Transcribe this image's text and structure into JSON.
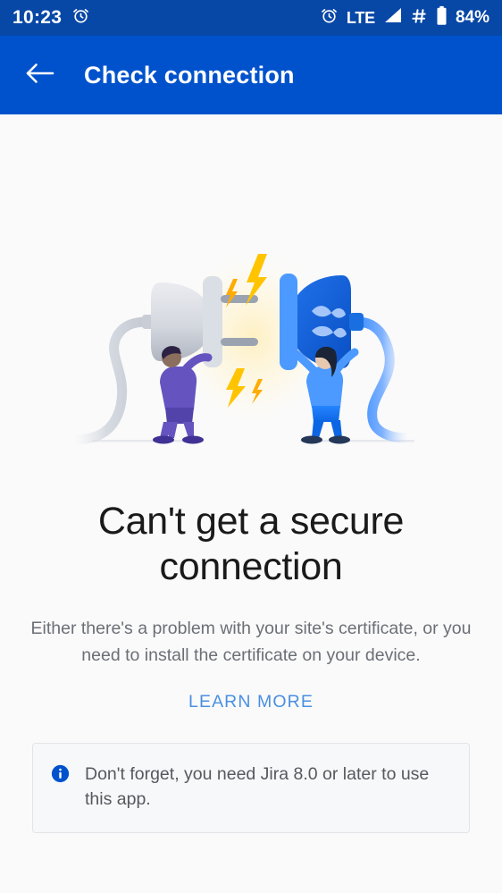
{
  "statusbar": {
    "time": "10:23",
    "alarm_icon": "alarm-clock-icon",
    "network_label": "LTE",
    "signal_icon": "signal-bars-icon",
    "hash_icon": "hash-icon",
    "battery_icon": "battery-icon",
    "battery_level": "84%",
    "background": "#0747A6"
  },
  "appbar": {
    "back_icon": "back-arrow-icon",
    "title": "Check connection",
    "background": "#0052CC"
  },
  "illustration": {
    "name": "disconnected-plug-illustration",
    "left_plug_color": "#C1C7D0",
    "right_socket_color": "#0052CC",
    "spark_color": "#FFAB00",
    "left_person_color": "#6554C0",
    "right_person_color": "#2684FF",
    "logo_mark": "atlassian-logo-mark"
  },
  "main": {
    "headline": "Can't get a secure connection",
    "body": "Either there's a problem with your site's certificate, or you need to install the certificate on your device.",
    "learn_more_label": "LEARN MORE",
    "learn_more_color": "#4A90E2"
  },
  "infobox": {
    "icon": "info-circle-icon",
    "icon_color": "#0052CC",
    "text": "Don't forget, you need Jira 8.0 or later to use this app.",
    "background": "#F7F8F9",
    "border": "#E2E4E8"
  }
}
